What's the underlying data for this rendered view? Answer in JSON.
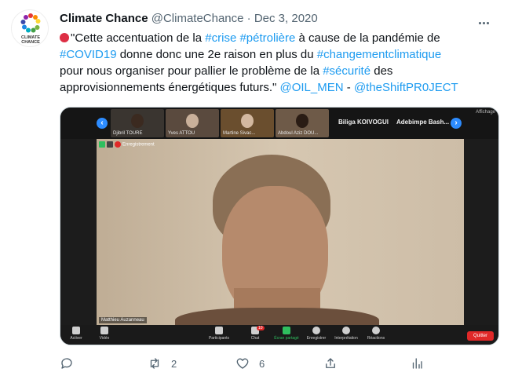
{
  "tweet": {
    "author_name": "Climate Chance",
    "author_handle": "@ClimateChance",
    "separator": "·",
    "date": "Dec 3, 2020",
    "avatar_text_1": "CLIMATE",
    "avatar_text_2": "CHANCE",
    "text_lines": [
      [
        {
          "t": "\"Cette accentuation de la ",
          "h": false
        },
        {
          "t": "#crise",
          "h": true
        },
        {
          "t": " ",
          "h": false
        },
        {
          "t": "#pétrolière",
          "h": true
        },
        {
          "t": " à cause de la pandémie de",
          "h": false
        }
      ],
      [
        {
          "t": "#COVID19",
          "h": true
        },
        {
          "t": " donne donc une 2e raison en plus du ",
          "h": false
        },
        {
          "t": "#changementclimatique",
          "h": true
        }
      ],
      [
        {
          "t": "pour nous organiser pour pallier le problème de la ",
          "h": false
        },
        {
          "t": "#sécurité",
          "h": true
        },
        {
          "t": " des",
          "h": false
        }
      ],
      [
        {
          "t": "approvisionnements énergétiques futurs.\" ",
          "h": false
        },
        {
          "t": "@OIL_MEN",
          "h": true
        },
        {
          "t": " - ",
          "h": false
        },
        {
          "t": "@theShiftPR0JECT",
          "h": true
        }
      ]
    ]
  },
  "media": {
    "thumbnails": [
      "Djibril TOURE",
      "Yves ATTOU",
      "Martine Sivac...",
      "Abdoul Aziz DOU..."
    ],
    "participant_names": [
      "Biliga KOIVOGUI",
      "Adebimpe  Bash..."
    ],
    "affichage": "Affichage",
    "recording_label": "Enregistrement",
    "speaker_name": "Matthieu Auzanneau",
    "toolbar": {
      "audio": "Activer",
      "video": "Vidéo",
      "participants": "Participants",
      "participants_count": "59",
      "chat": "Chat",
      "chat_badge": "10",
      "share": "Écran partagé",
      "record": "Enregistrer",
      "reactions_intl": "Interprétation",
      "reactions": "Réactions",
      "quit": "Quitter"
    }
  },
  "actions": {
    "retweets": "2",
    "likes": "6"
  },
  "colors": {
    "link": "#1d9bf0",
    "muted": "#536471",
    "zoom_blue": "#2d8cff",
    "zoom_red": "#e02828"
  }
}
